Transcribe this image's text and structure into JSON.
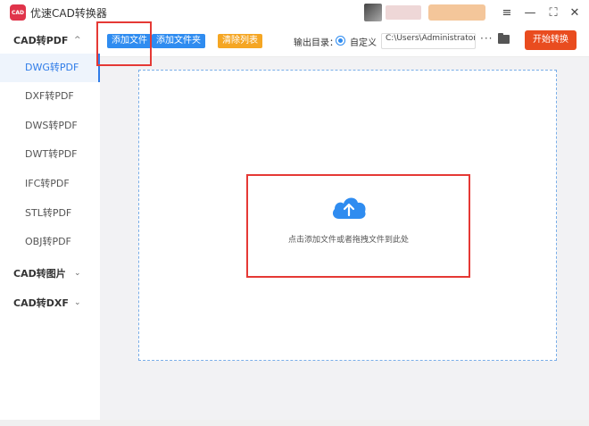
{
  "app": {
    "title": "优速CAD转换器",
    "logo_text": "CAD"
  },
  "window_controls": {
    "menu": "≡",
    "minimize": "—",
    "maximize": "⛶",
    "close": "✕"
  },
  "sidebar": {
    "groups": [
      {
        "label": "CAD转PDF",
        "chevron": "^",
        "items": [
          {
            "label": "DWG转PDF",
            "active": true
          },
          {
            "label": "DXF转PDF",
            "active": false
          },
          {
            "label": "DWS转PDF",
            "active": false
          },
          {
            "label": "DWT转PDF",
            "active": false
          },
          {
            "label": "IFC转PDF",
            "active": false
          },
          {
            "label": "STL转PDF",
            "active": false
          },
          {
            "label": "OBJ转PDF",
            "active": false
          }
        ]
      },
      {
        "label": "CAD转图片",
        "chevron": "⌄"
      },
      {
        "label": "CAD转DXF",
        "chevron": "⌄"
      }
    ]
  },
  "toolbar": {
    "add_file": "添加文件",
    "add_folder": "添加文件夹",
    "clear_list": "清除列表",
    "output_label": "输出目录：",
    "custom_label": "自定义",
    "output_path": "C:\\Users\\Administrator\\",
    "more": "···",
    "start": "开始转换"
  },
  "dropzone": {
    "hint": "点击添加文件或者拖拽文件到此处"
  },
  "colors": {
    "accent_blue": "#2f8cf0",
    "clear_orange": "#f5a623",
    "start_red": "#e94c1f",
    "annotation_red": "#e53935"
  }
}
